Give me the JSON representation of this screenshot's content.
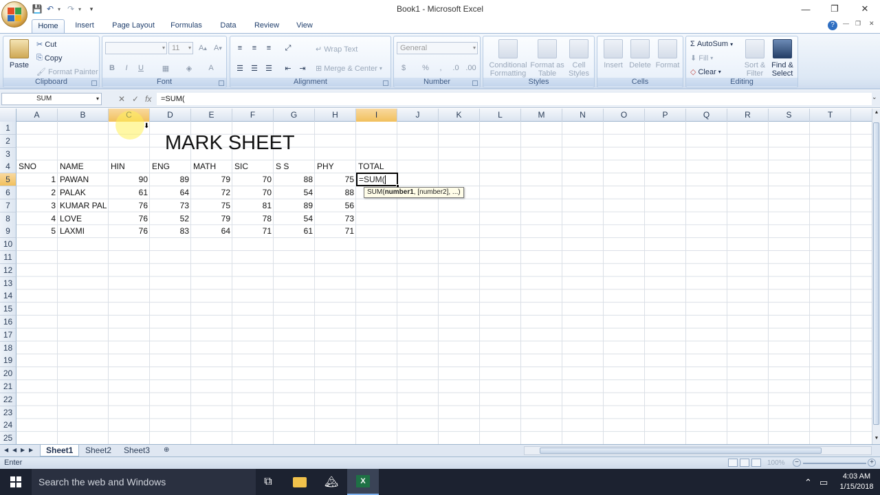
{
  "window": {
    "title": "Book1 - Microsoft Excel",
    "minimize": "—",
    "restore": "❐",
    "close": "✕"
  },
  "ribbon_tabs": [
    "Home",
    "Insert",
    "Page Layout",
    "Formulas",
    "Data",
    "Review",
    "View"
  ],
  "ribbon": {
    "clipboard": {
      "label": "Clipboard",
      "paste": "Paste",
      "cut": "Cut",
      "copy": "Copy",
      "format_painter": "Format Painter"
    },
    "font": {
      "label": "Font",
      "size": "11",
      "bold": "B",
      "italic": "I",
      "underline": "U"
    },
    "alignment": {
      "label": "Alignment",
      "wrap_text": "Wrap Text",
      "merge_center": "Merge & Center"
    },
    "number": {
      "label": "Number",
      "format": "General",
      "currency": "$",
      "percent": "%",
      "comma": ","
    },
    "styles": {
      "label": "Styles",
      "conditional": "Conditional Formatting",
      "format_table": "Format as Table",
      "cell_styles": "Cell Styles"
    },
    "cells": {
      "label": "Cells",
      "insert": "Insert",
      "delete": "Delete",
      "format": "Format"
    },
    "editing": {
      "label": "Editing",
      "autosum": "AutoSum",
      "fill": "Fill",
      "clear": "Clear",
      "sort_filter": "Sort & Filter",
      "find_select": "Find & Select"
    }
  },
  "formula_bar": {
    "name_box": "SUM",
    "cancel": "✕",
    "enter": "✓",
    "fx": "fx",
    "formula": "=SUM("
  },
  "columns": [
    "A",
    "B",
    "C",
    "D",
    "E",
    "F",
    "G",
    "H",
    "I",
    "J",
    "K",
    "L",
    "M",
    "N",
    "O",
    "P",
    "Q",
    "R",
    "S",
    "T"
  ],
  "rows": [
    "1",
    "2",
    "3",
    "4",
    "5",
    "6",
    "7",
    "8",
    "9",
    "10",
    "11",
    "12",
    "13",
    "14",
    "15",
    "16",
    "17",
    "18",
    "19",
    "20",
    "21",
    "22",
    "23",
    "24",
    "25"
  ],
  "sheet": {
    "title": "MARK SHEET",
    "headers": [
      "SNO",
      "NAME",
      "HIN",
      "ENG",
      "MATH",
      "SIC",
      "S S",
      "PHY",
      "TOTAL"
    ],
    "records": [
      [
        "1",
        "PAWAN",
        "90",
        "89",
        "79",
        "70",
        "88",
        "75"
      ],
      [
        "2",
        "PALAK",
        "61",
        "64",
        "72",
        "70",
        "54",
        "88"
      ],
      [
        "3",
        "KUMAR PAL",
        "76",
        "73",
        "75",
        "81",
        "89",
        "56"
      ],
      [
        "4",
        "LOVE",
        "76",
        "52",
        "79",
        "78",
        "54",
        "73"
      ],
      [
        "5",
        "LAXMI",
        "76",
        "83",
        "64",
        "71",
        "61",
        "71"
      ]
    ],
    "active_cell_text": "=SUM(",
    "tooltip_fn": "SUM(",
    "tooltip_arg1": "number1",
    "tooltip_rest": ", [number2], ...)"
  },
  "sheet_tabs": [
    "Sheet1",
    "Sheet2",
    "Sheet3"
  ],
  "status": {
    "mode": "Enter",
    "zoom": "100%"
  },
  "taskbar": {
    "search": "Search the web and Windows",
    "time": "4:03 AM",
    "date": "1/15/2018"
  }
}
